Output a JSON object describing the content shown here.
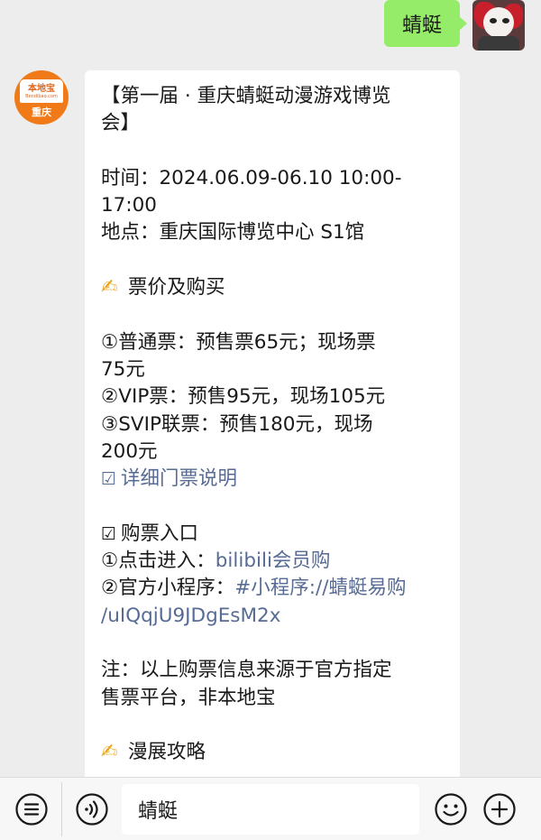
{
  "outgoing": {
    "text": "蜻蜓"
  },
  "incoming": {
    "avatar": {
      "name": "本地宝",
      "domain": "Bendibao.com",
      "city": "重庆"
    },
    "lines": {
      "title_1": "【第一届 · 重庆蜻蜓动漫游戏博览",
      "title_2": "会】",
      "time_1": "时间：2024.06.09-06.10 10:00-",
      "time_2": "17:00",
      "place": "地点：重庆国际博览中心 S1馆",
      "ticket_heading": "票价及购买",
      "t1_1": "①普通票：预售票65元；现场票",
      "t1_2": "75元",
      "t2": "②VIP票：预售95元，现场105元",
      "t3_1": "③SVIP联票：预售180元，现场",
      "t3_2": "200元",
      "detail_link": "详细门票说明",
      "buy_heading": "购票入口",
      "buy1_prefix": "①点击进入：",
      "buy1_link": "bilibili会员购",
      "buy2_prefix": "②官方小程序：",
      "buy2_link_1": "#小程序://蜻蜓易购",
      "buy2_link_2": "/uIQqjU9JDgEsM2x",
      "note_1": "注：以上购票信息来源于官方指定",
      "note_2": "售票平台，非本地宝",
      "guide_heading": "漫展攻略"
    },
    "icons": {
      "pen": "✍",
      "checkbox": "☑"
    }
  },
  "input_bar": {
    "text": "蜻蜓",
    "icons": [
      "menu-icon",
      "voice-icon",
      "emoji-icon",
      "plus-icon"
    ]
  },
  "colors": {
    "outgoing_bubble": "#95ec69",
    "link": "#576b95",
    "brand": "#f07a17"
  }
}
